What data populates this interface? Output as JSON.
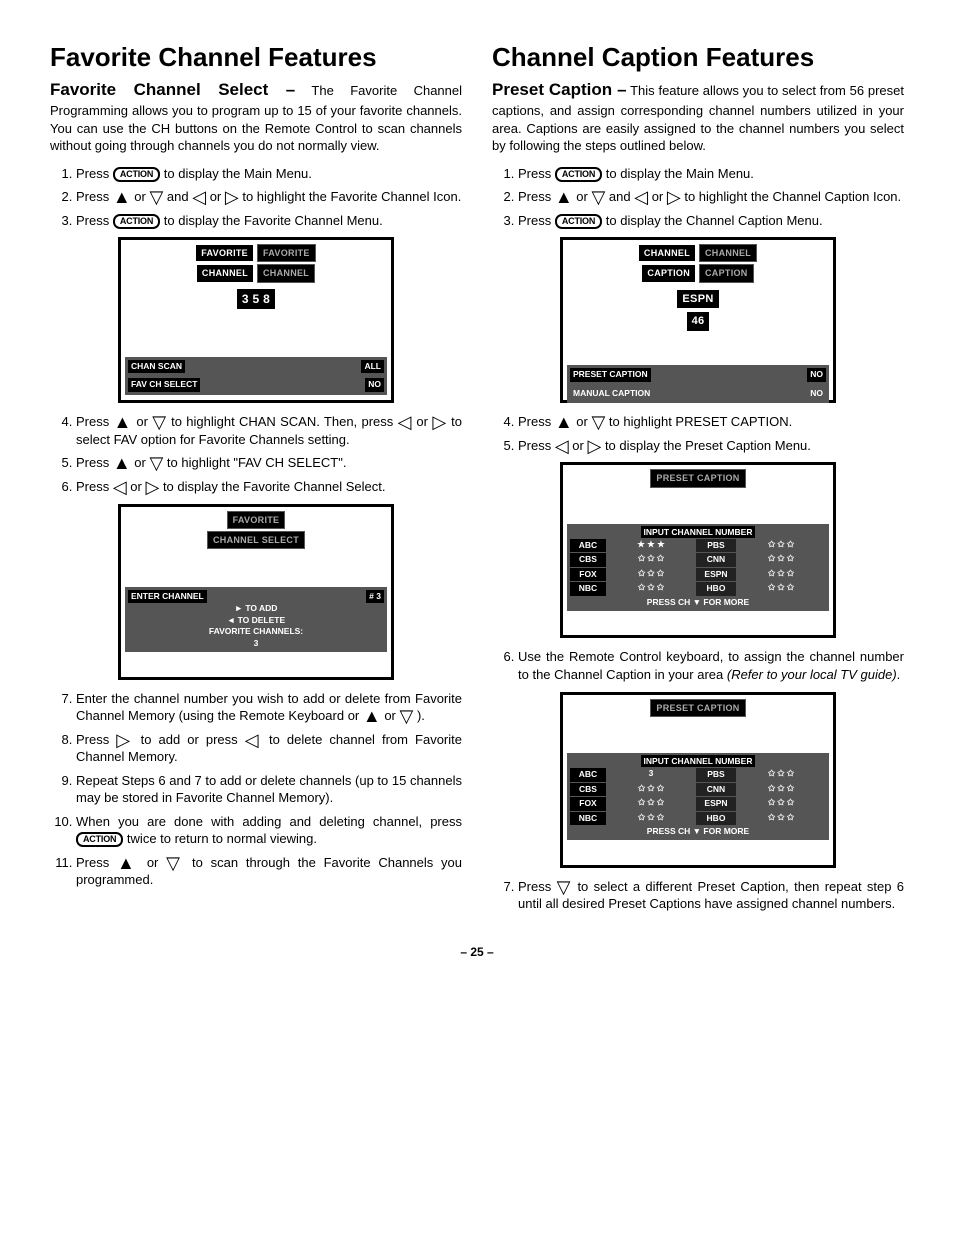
{
  "page_number": "– 25 –",
  "left": {
    "title": "Favorite Channel Features",
    "subhead": "Favorite Channel Select –",
    "intro": " The Favorite Channel Programming allows you to program up to 15 of your favorite channels. You can use the CH buttons on the Remote Control to scan channels without going through channels you do not normally view.",
    "steps": [
      "Press [ACTION] to display the Main Menu.",
      "Press ▲ or ▼ and ◄ or ► to highlight the Favorite Channel Icon.",
      "Press [ACTION] to display the Favorite Channel Menu.",
      "Press ▲ or ▼ to highlight CHAN SCAN. Then, press ◄ or ► to select FAV option for Favorite Channels setting.",
      "Press ▲ or ▼ to highlight \"FAV CH SELECT\".",
      "Press ◄ or ► to display the Favorite Channel Select.",
      "Enter the channel number you wish to add or delete from Favorite Channel Memory (using the Remote Keyboard or ▲ or ▼ ).",
      "Press ► to add or press ◄ to delete channel from Favorite Channel Memory.",
      "Repeat Steps 6 and 7 to add or delete channels (up to 15 channels may be stored in Favorite Channel Memory).",
      "When you are done with adding and deleting channel, press [ACTION] twice to return to normal viewing.",
      "Press ▲ or ▼ to scan through the Favorite Channels you programmed."
    ],
    "tv1": {
      "l1a": "FAVORITE",
      "l1b": "FAVORITE",
      "l2a": "CHANNEL",
      "l2b": "CHANNEL",
      "nums": "3  5  8",
      "b1a": "CHAN SCAN",
      "b1b": "ALL",
      "b2a": "FAV CH SELECT",
      "b2b": "NO"
    },
    "tv2": {
      "l1": "FAVORITE",
      "l2": "CHANNEL SELECT",
      "b1": "ENTER CHANNEL",
      "b1n": "#  3",
      "b2": "► TO ADD",
      "b3": "◄ TO DELETE",
      "b4": "FAVORITE CHANNELS:",
      "b5": "3"
    }
  },
  "right": {
    "title": "Channel Caption Features",
    "subhead": "Preset Caption –",
    "intro": " This feature allows you to select from 56 preset captions, and assign corresponding channel numbers utilized in your area. Captions are easily assigned to the channel numbers you select by following the steps outlined below.",
    "steps": [
      "Press [ACTION] to display the Main Menu.",
      "Press ▲ or ▼ and ◄ or ► to highlight the Channel Caption Icon.",
      "Press [ACTION] to display the Channel Caption Menu.",
      "Press ▲ or ▼ to highlight PRESET CAPTION.",
      "Press ◄ or ► to display the Preset Caption Menu.",
      "Use the Remote Control keyboard, to assign the channel number to the Channel Caption in your area (Refer to your local TV guide).",
      "Press ▼ to select a different Preset Caption, then repeat step 6 until all desired Preset Captions have assigned channel numbers."
    ],
    "tv1": {
      "l1a": "CHANNEL",
      "l1b": "CHANNEL",
      "l2a": "CAPTION",
      "l2b": "CAPTION",
      "box1": "ESPN",
      "box2": "46",
      "b1a": "PRESET CAPTION",
      "b1b": "NO",
      "b2a": "MANUAL CAPTION",
      "b2b": "NO"
    },
    "tv2": {
      "title": "PRESET CAPTION",
      "head": "INPUT CHANNEL NUMBER",
      "rows": [
        [
          "ABC",
          "★ ★ ★",
          "PBS",
          "✩ ✩ ✩"
        ],
        [
          "CBS",
          "✩ ✩ ✩",
          "CNN",
          "✩ ✩ ✩"
        ],
        [
          "FOX",
          "✩ ✩ ✩",
          "ESPN",
          "✩ ✩ ✩"
        ],
        [
          "NBC",
          "✩ ✩ ✩",
          "HBO",
          "✩ ✩ ✩"
        ]
      ],
      "foot": "PRESS CH ▼ FOR MORE"
    },
    "tv3": {
      "title": "PRESET CAPTION",
      "head": "INPUT CHANNEL NUMBER",
      "rows": [
        [
          "ABC",
          "3",
          "PBS",
          "✩ ✩ ✩"
        ],
        [
          "CBS",
          "✩ ✩ ✩",
          "CNN",
          "✩ ✩ ✩"
        ],
        [
          "FOX",
          "✩ ✩ ✩",
          "ESPN",
          "✩ ✩ ✩"
        ],
        [
          "NBC",
          "✩ ✩ ✩",
          "HBO",
          "✩ ✩ ✩"
        ]
      ],
      "foot": "PRESS CH ▼ FOR MORE"
    }
  },
  "icon_labels": {
    "action": "ACTION"
  }
}
